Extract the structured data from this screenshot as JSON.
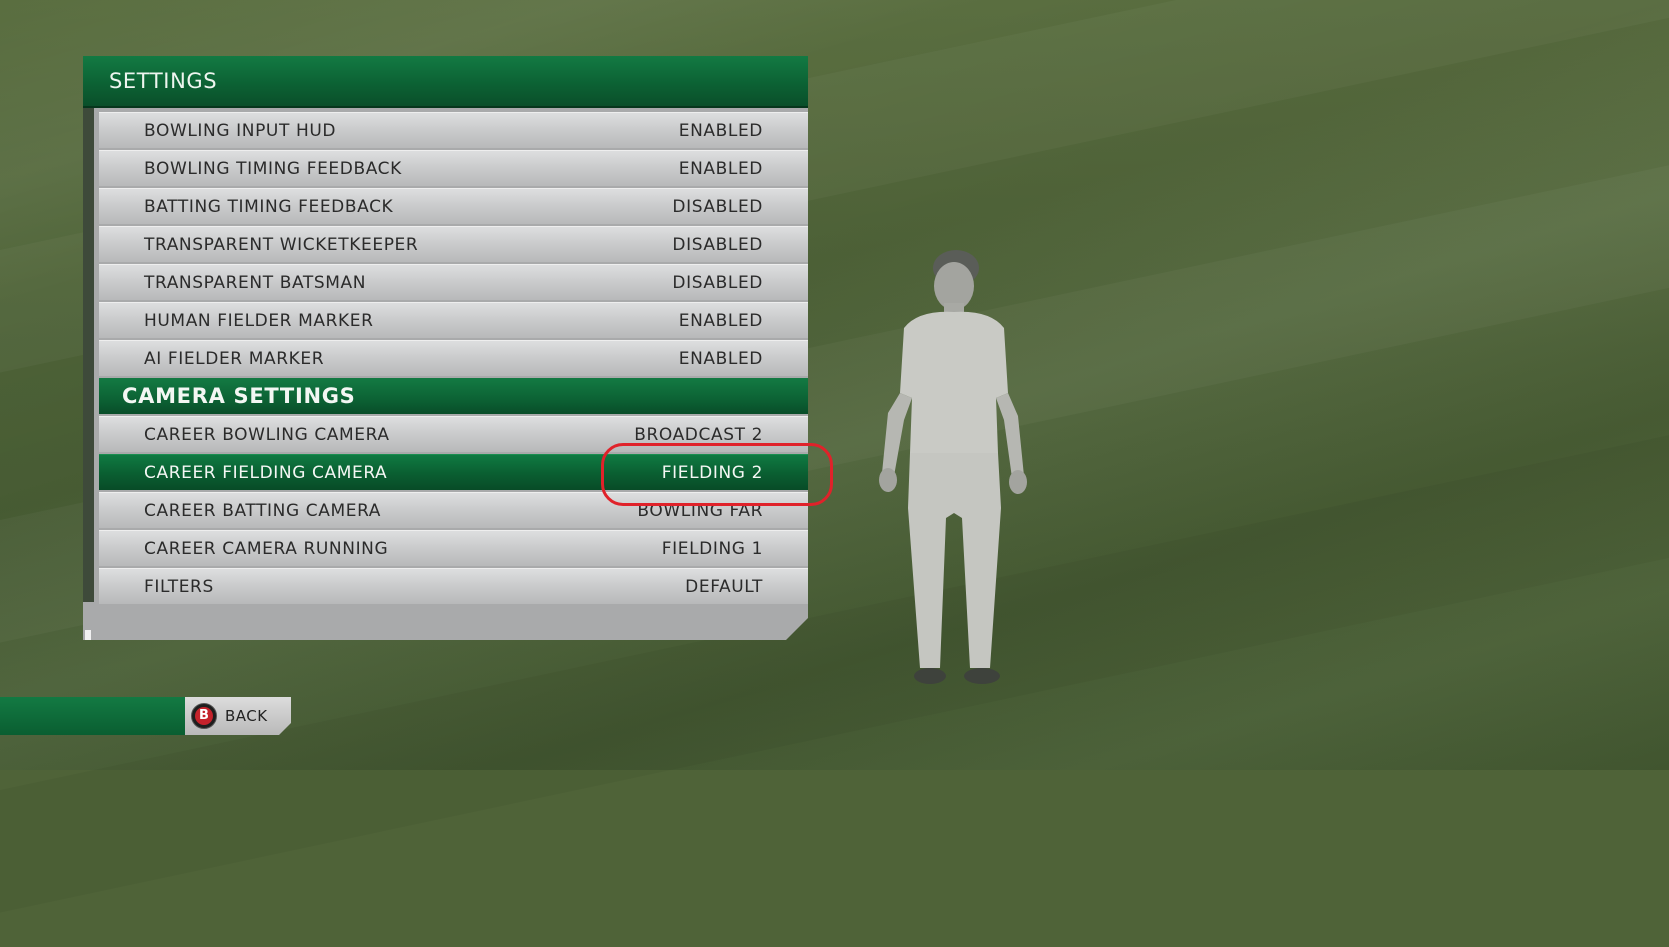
{
  "panel": {
    "title": "SETTINGS"
  },
  "settings": [
    {
      "label": "BOWLING INPUT HUD",
      "value": "ENABLED"
    },
    {
      "label": "BOWLING TIMING FEEDBACK",
      "value": "ENABLED"
    },
    {
      "label": "BATTING TIMING FEEDBACK",
      "value": "DISABLED"
    },
    {
      "label": "TRANSPARENT WICKETKEEPER",
      "value": "DISABLED"
    },
    {
      "label": "TRANSPARENT BATSMAN",
      "value": "DISABLED"
    },
    {
      "label": "HUMAN FIELDER MARKER",
      "value": "ENABLED"
    },
    {
      "label": "AI FIELDER MARKER",
      "value": "ENABLED"
    }
  ],
  "camera_section": {
    "title": "CAMERA SETTINGS"
  },
  "camera": [
    {
      "label": "CAREER BOWLING CAMERA",
      "value": "BROADCAST 2"
    },
    {
      "label": "CAREER FIELDING CAMERA",
      "value": "FIELDING 2",
      "selected": true
    },
    {
      "label": "CAREER BATTING CAMERA",
      "value": "BOWLING FAR"
    },
    {
      "label": "CAREER CAMERA RUNNING",
      "value": "FIELDING 1"
    },
    {
      "label": "FILTERS",
      "value": "DEFAULT"
    }
  ],
  "footer": {
    "button_key": "B",
    "back_label": "BACK"
  },
  "colors": {
    "accent_green": "#0c6234",
    "highlight_ring": "#e0222a",
    "button_b": "#c4222b"
  }
}
